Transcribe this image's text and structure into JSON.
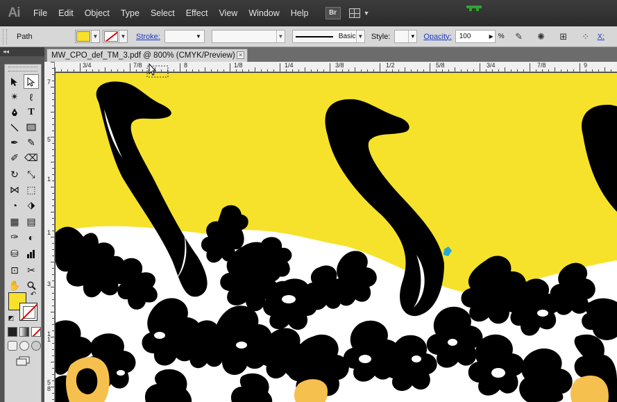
{
  "app": {
    "logo": "Ai"
  },
  "menu": [
    "File",
    "Edit",
    "Object",
    "Type",
    "Select",
    "Effect",
    "View",
    "Window",
    "Help"
  ],
  "menubar": {
    "bridge_label": "Br"
  },
  "control": {
    "selection_type": "Path",
    "stroke_label": "Stroke:",
    "brush_label": "Basic",
    "style_label": "Style:",
    "opacity_label": "Opacity:",
    "opacity_value": "100",
    "opacity_unit": "%",
    "x_label": "X:"
  },
  "document": {
    "tab_title": "MW_CPO_def_TM_3.pdf @ 800% (CMYK/Preview)",
    "close_glyph": "×"
  },
  "panel": {
    "collapse_glyph": "◂◂"
  },
  "hruler": {
    "labels": [
      "3/4",
      "7/8",
      "8",
      "1/8",
      "1/4",
      "3/8",
      "1/2",
      "5/8",
      "3/4",
      "7/8",
      "9"
    ]
  },
  "vruler": {
    "labels": [
      "7",
      "5",
      "1",
      "1",
      "3",
      "1",
      "1",
      "5",
      "8"
    ]
  },
  "colors": {
    "canvas_yellow": "#f6e22a",
    "shape_black": "#000000",
    "fill_swatch": "#f7e12b",
    "accent_orange": "#f6c04f",
    "anchor_cyan": "#23a9d6"
  },
  "icons": [
    "selection-tool-icon",
    "direct-selection-tool-icon",
    "pen-tool-icon",
    "type-tool-icon",
    "fill-color-swatch",
    "stroke-color-swatch"
  ]
}
